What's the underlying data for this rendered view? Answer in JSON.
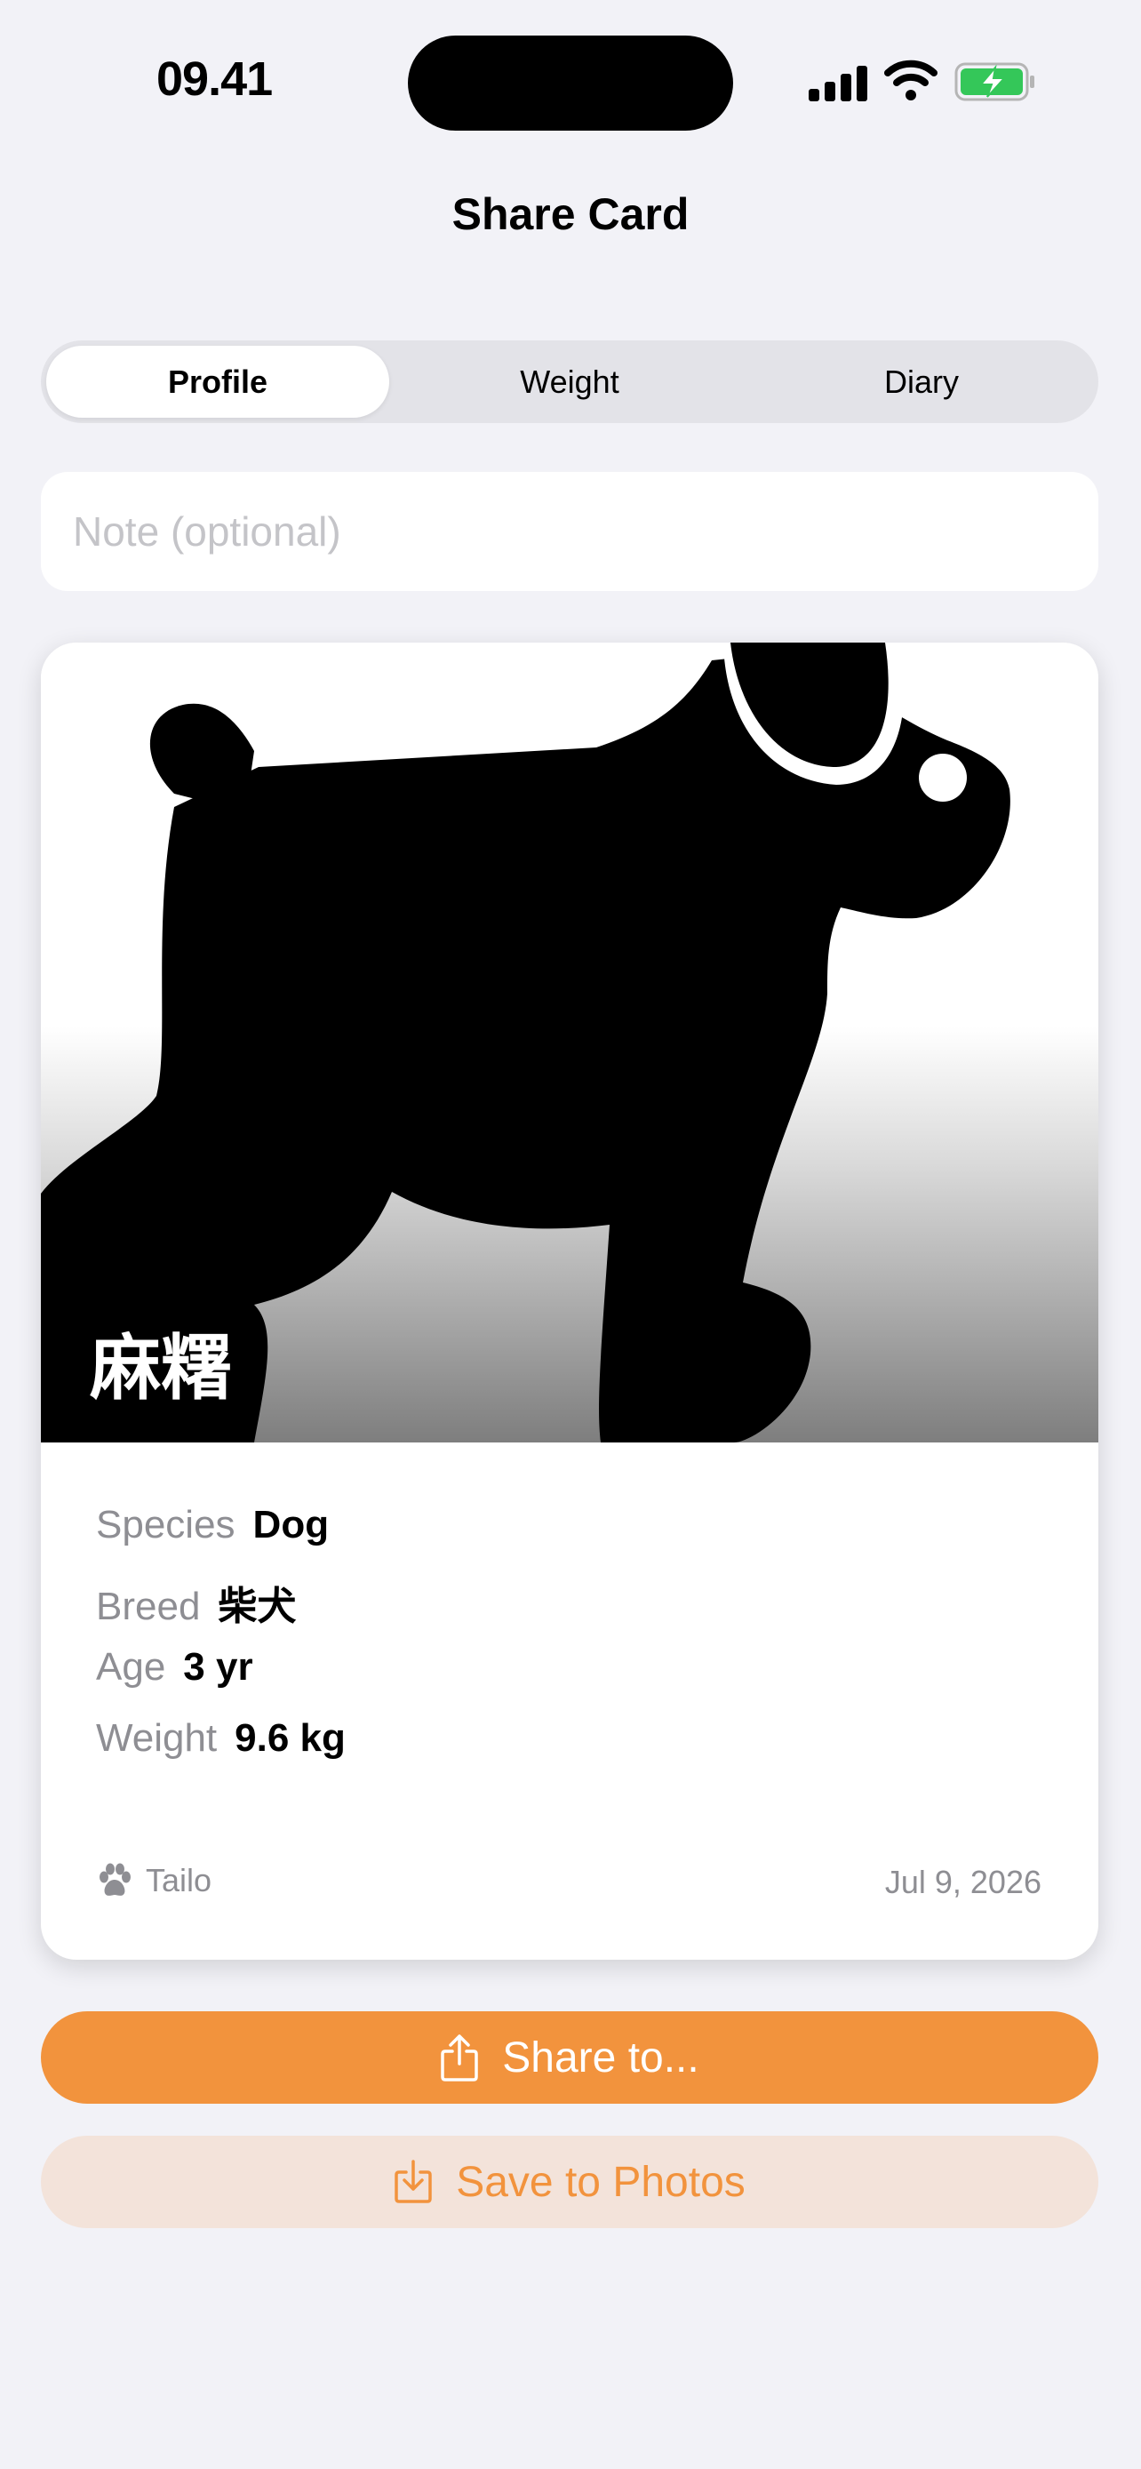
{
  "status_bar": {
    "time": "09.41"
  },
  "nav": {
    "title": "Share Card"
  },
  "segmented": {
    "tabs": [
      "Profile",
      "Weight",
      "Diary"
    ],
    "selected": "Profile"
  },
  "note": {
    "placeholder": "Note (optional)",
    "value": ""
  },
  "card": {
    "pet_name": "麻糬",
    "fields": [
      {
        "label": "Species",
        "value": "Dog"
      },
      {
        "label": "Breed",
        "value": "柴犬"
      },
      {
        "label": "Age",
        "value": "3 yr"
      },
      {
        "label": "Weight",
        "value": "9.6 kg"
      }
    ],
    "brand": "Tailo",
    "date": "Jul 9, 2026",
    "photo_icon": "dog-silhouette-icon"
  },
  "actions": {
    "share_label": "Share to...",
    "save_label": "Save to Photos"
  },
  "colors": {
    "accent": "#f2933d",
    "accent_soft": "#f3e3da",
    "background": "#f2f2f7"
  }
}
